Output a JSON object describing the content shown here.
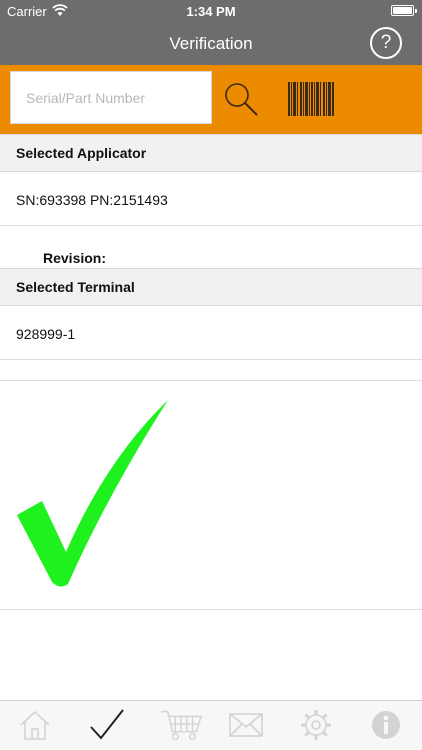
{
  "status_bar": {
    "carrier": "Carrier",
    "time": "1:34 PM"
  },
  "nav": {
    "title": "Verification",
    "help_label": "?"
  },
  "search": {
    "placeholder": "Serial/Part Number",
    "value": ""
  },
  "applicator": {
    "header": "Selected Applicator",
    "serial_part": "SN:693398 PN:2151493",
    "revision_label": "Revision:"
  },
  "terminal": {
    "header": "Selected Terminal",
    "value": "928999-1"
  },
  "result": {
    "icon": "check-mark-icon",
    "color": "#1ef11e"
  },
  "colors": {
    "nav_bar": "#6d6d6d",
    "search_bar": "#ec8a00",
    "tab_icon_inactive": "#d3d3d3",
    "tab_icon_active": "#222222"
  },
  "tabs": [
    {
      "icon": "home-icon",
      "active": false
    },
    {
      "icon": "checkmark-icon",
      "active": true
    },
    {
      "icon": "cart-icon",
      "active": false
    },
    {
      "icon": "mail-icon",
      "active": false
    },
    {
      "icon": "gear-icon",
      "active": false
    },
    {
      "icon": "info-icon",
      "active": false
    }
  ]
}
